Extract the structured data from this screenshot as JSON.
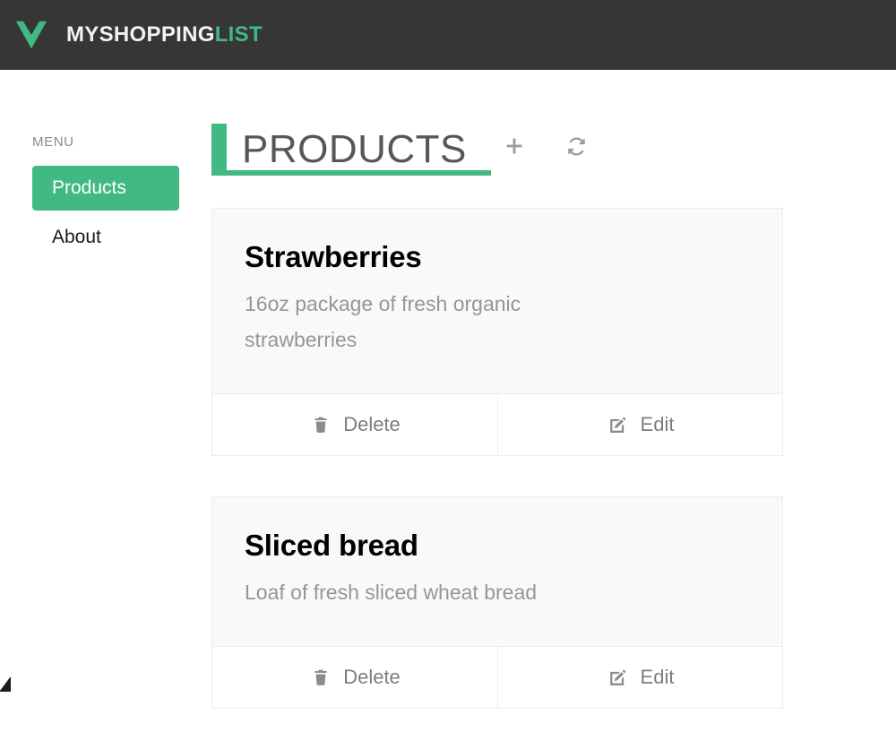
{
  "header": {
    "logo_icon": "vue-logo-icon",
    "brand_primary": "MYSHOPPING",
    "brand_accent": "LIST"
  },
  "sidebar": {
    "label": "MENU",
    "items": [
      {
        "label": "Products",
        "active": true
      },
      {
        "label": "About",
        "active": false
      }
    ]
  },
  "main": {
    "title": "PRODUCTS",
    "actions": [
      {
        "name": "add-product-button",
        "icon": "plus-icon"
      },
      {
        "name": "refresh-button",
        "icon": "refresh-icon"
      }
    ],
    "products": [
      {
        "name": "Strawberries",
        "description": "16oz package of fresh organic strawberries",
        "delete_label": "Delete",
        "edit_label": "Edit"
      },
      {
        "name": "Sliced bread",
        "description": "Loaf of fresh sliced wheat bread",
        "delete_label": "Delete",
        "edit_label": "Edit"
      }
    ]
  },
  "colors": {
    "accent_green": "#42b883",
    "header_dark": "#363636",
    "card_bg": "#f9f9f9",
    "muted_text": "#969696"
  }
}
